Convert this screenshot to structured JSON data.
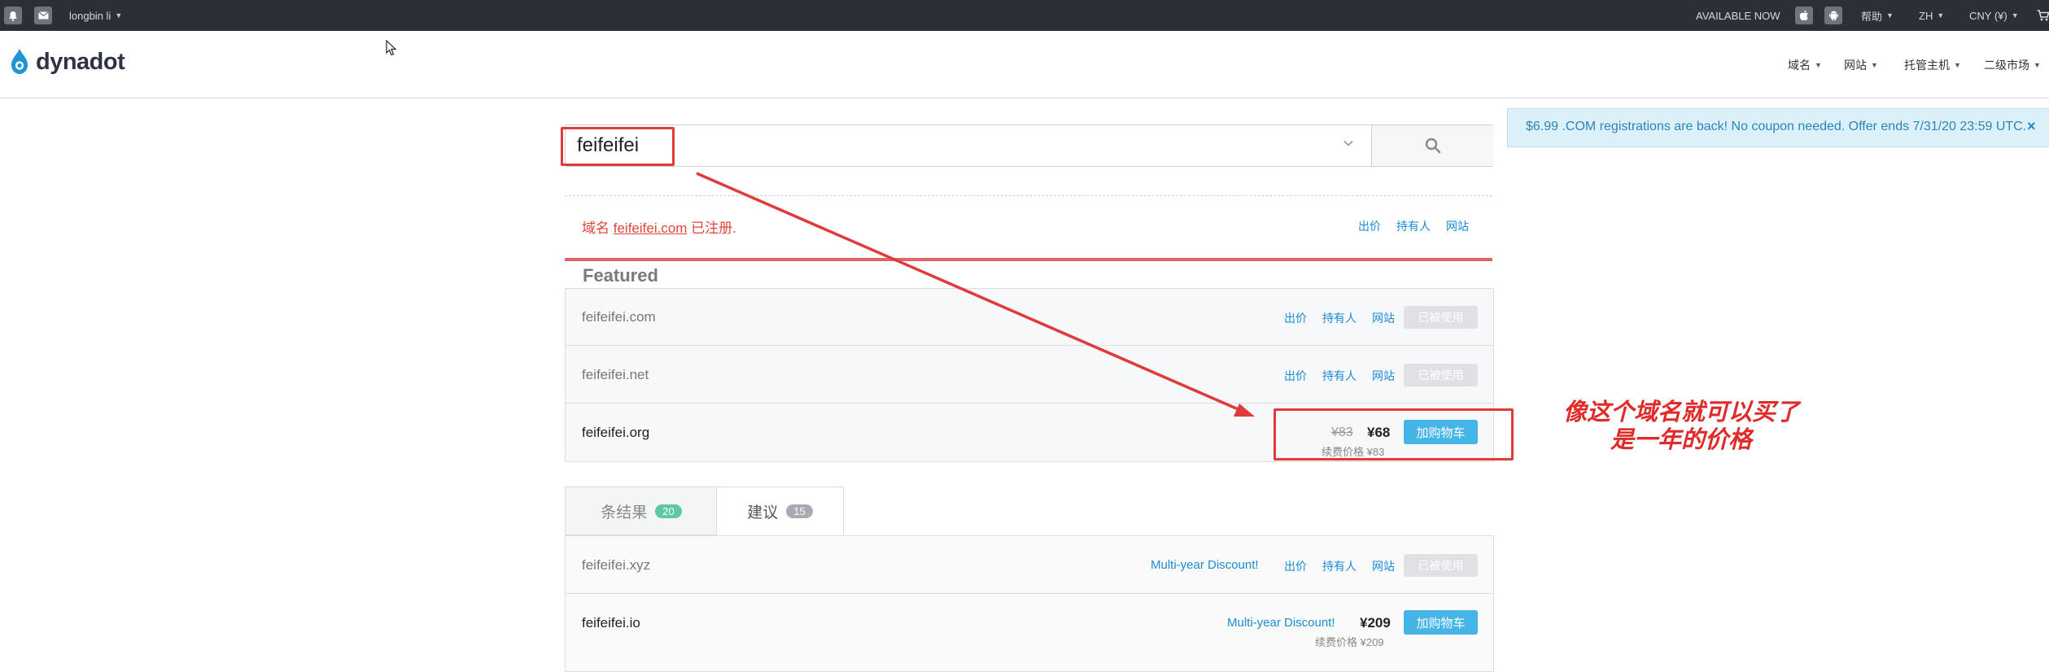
{
  "topbar": {
    "user": "longbin li",
    "available": "AVAILABLE NOW",
    "help": "帮助",
    "lang": "ZH",
    "currency": "CNY (¥)"
  },
  "header": {
    "logo": "dynadot",
    "nav": [
      "域名",
      "网站",
      "托管主机",
      "二级市场"
    ]
  },
  "search": {
    "query": "feifeifei"
  },
  "promo": {
    "text": "$6.99 .COM registrations are back! No coupon needed. Offer ends 7/31/20 23:59 UTC.",
    "close": "×"
  },
  "result": {
    "prefix": "域名",
    "domain": "feifeifei.com",
    "suffix": "已注册.",
    "links": [
      "出价",
      "持有人",
      "网站"
    ]
  },
  "featured": {
    "title": "Featured",
    "rows": [
      {
        "domain": "feifeifei.com",
        "links": [
          "出价",
          "持有人",
          "网站"
        ],
        "button": "已被使用"
      },
      {
        "domain": "feifeifei.net",
        "links": [
          "出价",
          "持有人",
          "网站"
        ],
        "button": "已被使用"
      },
      {
        "domain": "feifeifei.org",
        "old_price": "¥83",
        "price": "¥68",
        "renew": "续费价格 ¥83",
        "button": "加购物车"
      }
    ]
  },
  "tabs": [
    {
      "label": "条结果",
      "count": "20",
      "color": "#5cc9a0"
    },
    {
      "label": "建议",
      "count": "15",
      "color": "#a8acb2"
    }
  ],
  "results": [
    {
      "domain": "feifeifei.xyz",
      "discount": "Multi-year Discount!",
      "links": [
        "出价",
        "持有人",
        "网站"
      ],
      "button": "已被使用"
    },
    {
      "domain": "feifeifei.io",
      "discount": "Multi-year Discount!",
      "price": "¥209",
      "renew": "续费价格 ¥209",
      "button": "加购物车"
    }
  ],
  "annotation": {
    "line1": "像这个域名就可以买了",
    "line2": "是一年的价格",
    "color": "#e03a3a"
  },
  "colors": {
    "topbar_bg": "#2b2f36",
    "link_blue": "#1a8ad3",
    "cart_blue": "#45b4e7",
    "taken_red": "#e0473c"
  }
}
